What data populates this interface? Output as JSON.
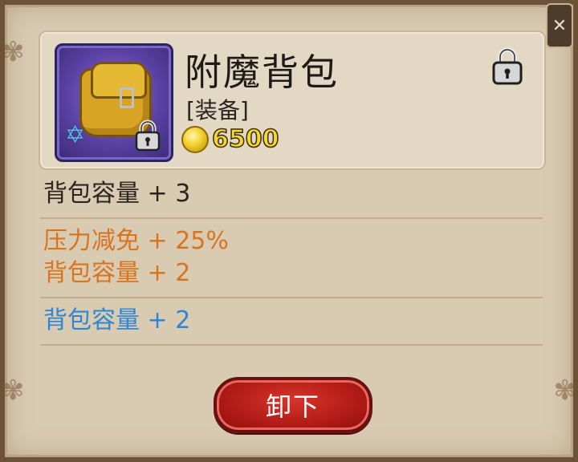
{
  "item": {
    "name": "附魔背包",
    "type_label": "[装备]",
    "price": "6500",
    "icon": "backpack-icon",
    "badge_icon": "star-of-david-icon",
    "locked": true
  },
  "base_stats": [
    {
      "text": "背包容量 + 3",
      "color": "#2b241f"
    }
  ],
  "bonus_stats": [
    {
      "text": "压力减免 + 25%",
      "color": "#d8741f"
    },
    {
      "text": "背包容量 + 2",
      "color": "#d8741f"
    }
  ],
  "extra_stats": [
    {
      "text": "背包容量 + 2",
      "color": "#2f86d4"
    }
  ],
  "actions": {
    "unequip_label": "卸下"
  },
  "colors": {
    "panel_bg": "#d9cbb2",
    "button_red": "#b01b16",
    "coin_gold": "#f3d72c"
  }
}
